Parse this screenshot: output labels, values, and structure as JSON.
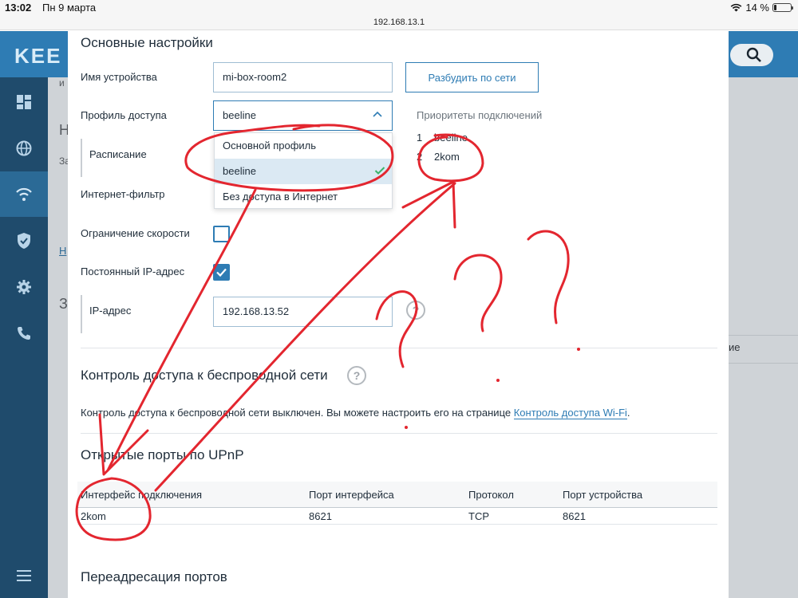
{
  "statusbar": {
    "time": "13:02",
    "date": "Пн 9 марта",
    "battery": "14 %",
    "battery_level": 0.14
  },
  "browser": {
    "url": "192.168.13.1"
  },
  "background": {
    "logo": "KEE",
    "stub_texts": [
      "и",
      "Н",
      "За",
      "Н",
      "З",
      "ие"
    ]
  },
  "modal": {
    "title": "Основные настройки",
    "device_name_label": "Имя устройства",
    "device_name_value": "mi-box-room2",
    "wake_button": "Разбудить по сети",
    "access_profile_label": "Профиль доступа",
    "access_profile_value": "beeline",
    "dropdown_options": [
      "Основной профиль",
      "beeline",
      "Без доступа в Интернет"
    ],
    "dropdown_selected": "beeline",
    "schedule_label": "Расписание",
    "priority_title": "Приоритеты подключений",
    "priorities": [
      {
        "n": "1",
        "name": "beeline"
      },
      {
        "n": "2",
        "name": "2kom"
      }
    ],
    "internet_filter_label": "Интернет-фильтр",
    "speed_limit_label": "Ограничение скорости",
    "speed_limit_checked": false,
    "static_ip_label": "Постоянный IP-адрес",
    "static_ip_checked": true,
    "ip_label": "IP-адрес",
    "ip_value": "192.168.13.52",
    "help_glyph": "?"
  },
  "wireless": {
    "title": "Контроль доступа к беспроводной сети",
    "text": "Контроль доступа к беспроводной сети выключен. Вы можете настроить его на странице",
    "link": "Контроль доступа Wi-Fi",
    "text_end": "."
  },
  "upnp": {
    "title": "Открытые порты по UPnP",
    "columns": [
      "Интерфейс подключения",
      "Порт интерфейса",
      "Протокол",
      "Порт устройства"
    ],
    "rows": [
      [
        "2kom",
        "8621",
        "TCP",
        "8621"
      ]
    ]
  },
  "port_forwarding": {
    "title": "Переадресация портов"
  },
  "colors": {
    "accent": "#2e7cb4",
    "annotation": "#e3262f",
    "header": "#2e7cb4",
    "sidebar": "#1f4b6c"
  }
}
